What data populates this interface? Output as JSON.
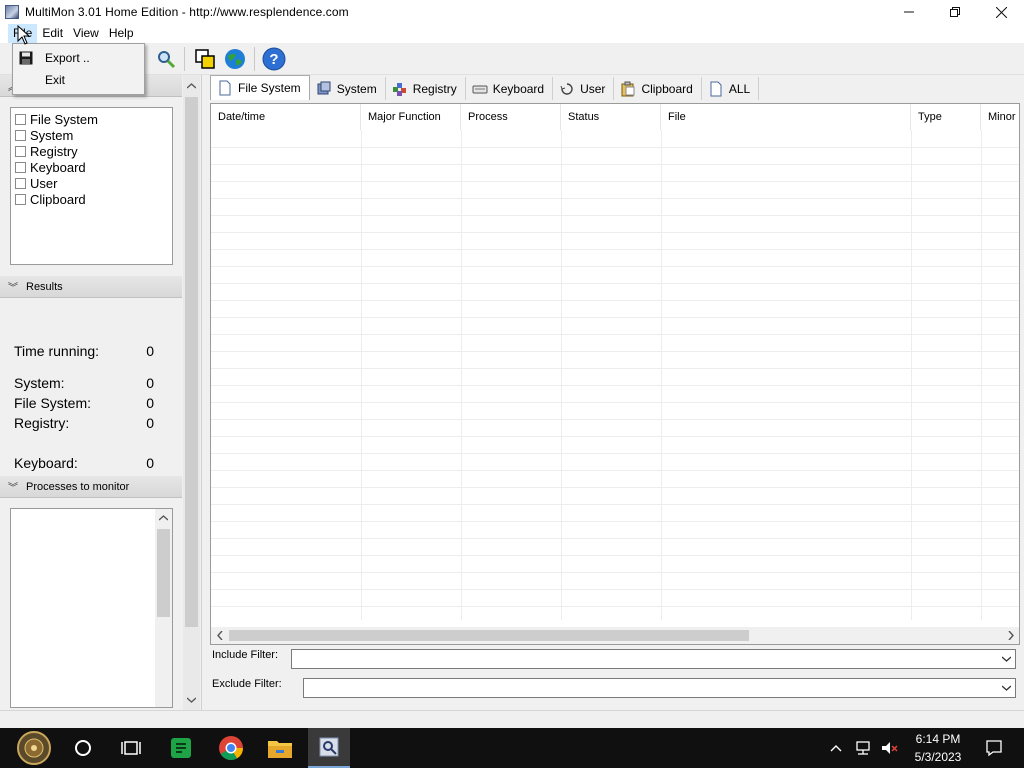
{
  "window": {
    "title": "MultiMon 3.01  Home Edition -  http://www.resplendence.com"
  },
  "menubar": {
    "items": [
      "File",
      "Edit",
      "View",
      "Help"
    ]
  },
  "file_menu": {
    "items": [
      "Export ..",
      "Exit"
    ]
  },
  "monitor_list": {
    "items": [
      "File System",
      "System",
      "Registry",
      "Keyboard",
      "User",
      "Clipboard"
    ]
  },
  "results": {
    "header": "Results",
    "stats": [
      {
        "label": "Time running:",
        "value": "0"
      },
      {
        "label": "System:",
        "value": "0"
      },
      {
        "label": "File System:",
        "value": "0"
      },
      {
        "label": "Registry:",
        "value": "0"
      },
      {
        "label": "Keyboard:",
        "value": "0"
      }
    ]
  },
  "processes": {
    "header": "Processes to monitor"
  },
  "tabs": [
    "File System",
    "System",
    "Registry",
    "Keyboard",
    "User",
    "Clipboard",
    "ALL"
  ],
  "grid": {
    "columns": [
      "Date/time",
      "Major Function",
      "Process",
      "Status",
      "File",
      "Type",
      "Minor"
    ]
  },
  "filters": {
    "include_label": "Include Filter:",
    "exclude_label": "Exclude Filter:",
    "include_value": "",
    "exclude_value": ""
  },
  "taskbar": {
    "time": "6:14 PM",
    "date": "5/3/2023"
  }
}
